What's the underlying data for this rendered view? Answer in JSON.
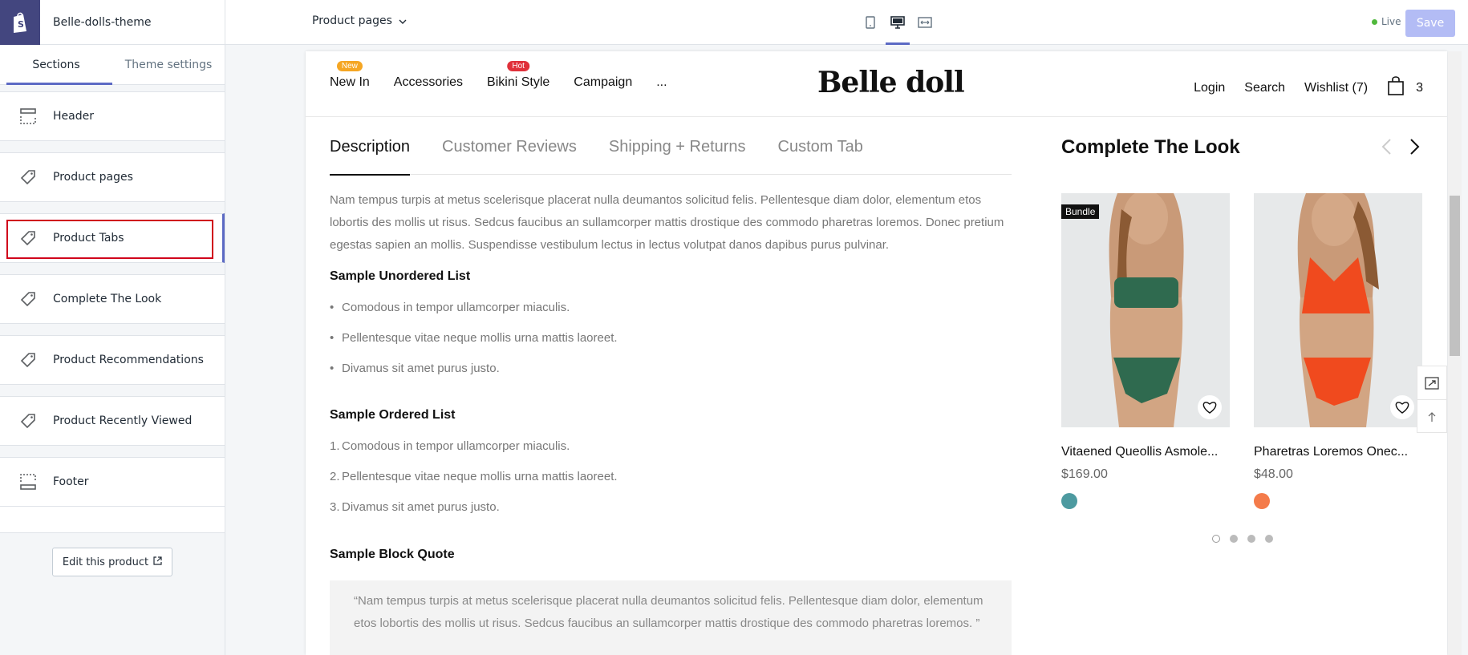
{
  "sidebar": {
    "theme_name": "Belle-dolls-theme",
    "tabs": [
      {
        "label": "Sections"
      },
      {
        "label": "Theme settings"
      }
    ],
    "sections": [
      {
        "label": "Header",
        "icon": "header-layout-icon"
      },
      {
        "label": "Product pages",
        "icon": "tag-icon"
      },
      {
        "label": "Product Tabs",
        "icon": "tag-icon"
      },
      {
        "label": "Complete The Look",
        "icon": "tag-icon"
      },
      {
        "label": "Product Recommendations",
        "icon": "tag-icon"
      },
      {
        "label": "Product Recently Viewed",
        "icon": "tag-icon"
      },
      {
        "label": "Footer",
        "icon": "footer-layout-icon"
      }
    ],
    "edit_button": "Edit this product"
  },
  "topbar": {
    "page_select": "Product pages",
    "live_label": "Live",
    "save_label": "Save"
  },
  "store": {
    "nav": [
      {
        "label": "New In",
        "badge": "New",
        "badge_color": "#f5a623"
      },
      {
        "label": "Accessories"
      },
      {
        "label": "Bikini Style",
        "badge": "Hot",
        "badge_color": "#e0303a"
      },
      {
        "label": "Campaign"
      },
      {
        "label": "..."
      }
    ],
    "logo": "Belle doll",
    "account": {
      "login": "Login",
      "search": "Search",
      "wishlist": "Wishlist (7)",
      "cart_count": "3"
    },
    "tabs": [
      {
        "label": "Description"
      },
      {
        "label": "Customer Reviews"
      },
      {
        "label": "Shipping + Returns"
      },
      {
        "label": "Custom Tab"
      }
    ],
    "description": "Nam tempus turpis at metus scelerisque placerat nulla deumantos solicitud felis. Pellentesque diam dolor, elementum etos lobortis des mollis ut risus. Sedcus faucibus an sullamcorper mattis drostique des commodo pharetras loremos. Donec pretium egestas sapien an mollis. Suspendisse vestibulum lectus in lectus volutpat danos dapibus purus pulvinar.",
    "unordered_heading": "Sample Unordered List",
    "unordered_items": [
      "Comodous in tempor ullamcorper miaculis.",
      "Pellentesque vitae neque mollis urna mattis laoreet.",
      "Divamus sit amet purus justo."
    ],
    "ordered_heading": "Sample Ordered List",
    "ordered_markers": [
      "1.",
      "2.",
      "3."
    ],
    "ordered_items": [
      "Comodous in tempor ullamcorper miaculis.",
      "Pellentesque vitae neque mollis urna mattis laoreet.",
      "Divamus sit amet purus justo."
    ],
    "quote_heading": "Sample Block Quote",
    "quote": "“Nam tempus turpis at metus scelerisque placerat nulla deumantos solicitud felis. Pellentesque diam dolor, elementum etos lobortis des mollis ut risus. Sedcus faucibus an sullamcorper mattis drostique des commodo pharetras loremos. ”",
    "complete_look": {
      "title": "Complete The Look",
      "products": [
        {
          "name": "Vitaened Queollis Asmole...",
          "price": "$169.00",
          "badge": "Bundle",
          "swatch": "#4d9aa0",
          "bikini_color": "#2f6a4f"
        },
        {
          "name": "Pharetras Loremos Onec...",
          "price": "$48.00",
          "swatch": "#f47b4a",
          "bikini_color": "#f04a1e"
        }
      ],
      "pagination": 4
    }
  }
}
